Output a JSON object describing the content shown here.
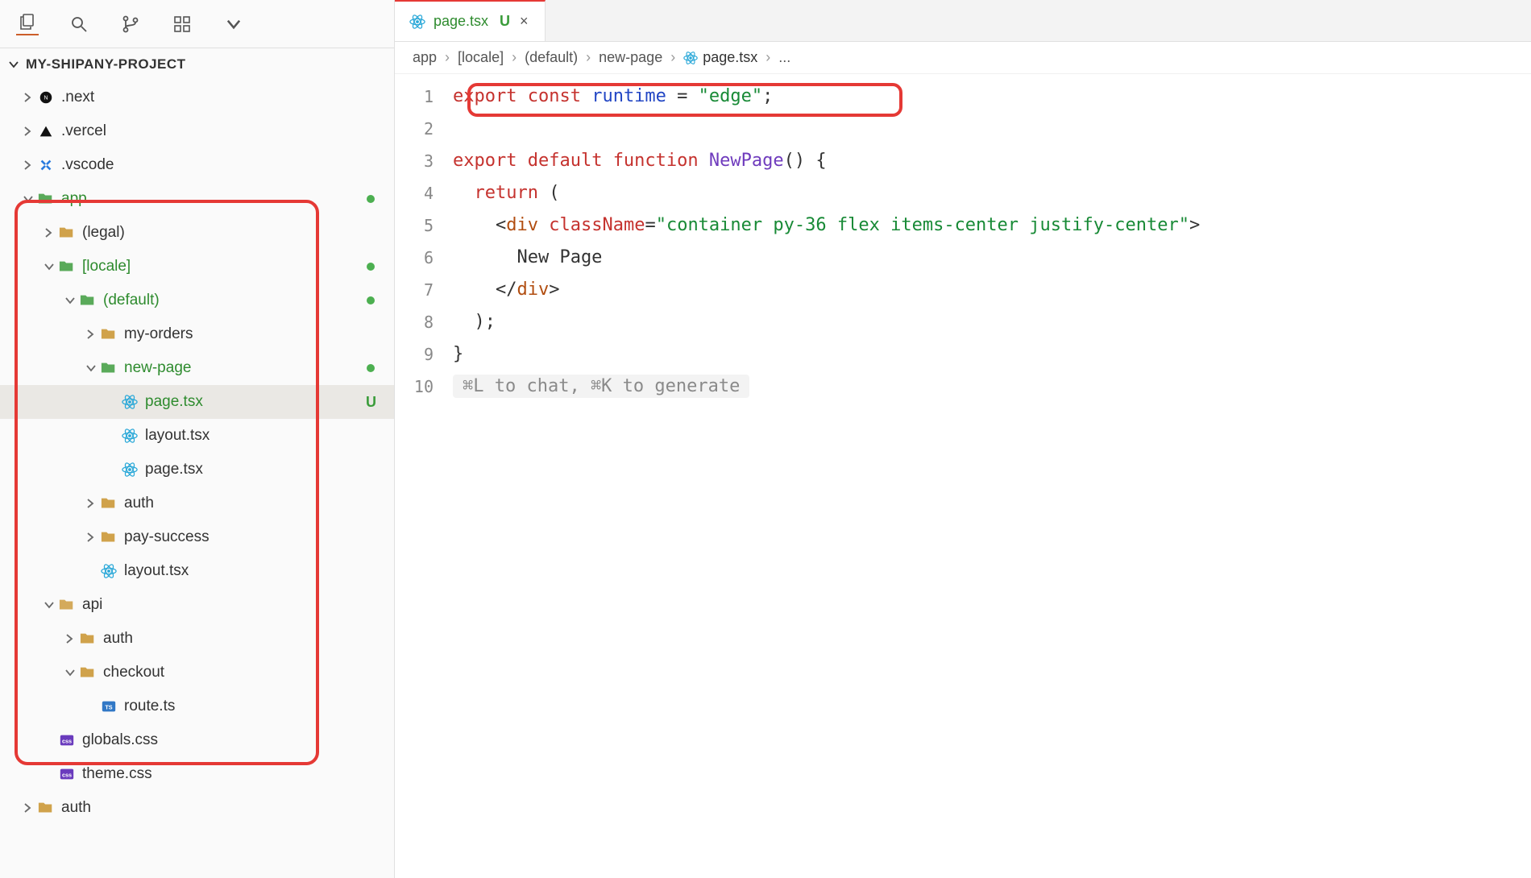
{
  "sidebar_top": {
    "icons": [
      "files-icon",
      "search-icon",
      "git-branch-icon",
      "extensions-icon",
      "chevron-down-icon"
    ]
  },
  "project": {
    "name": "MY-SHIPANY-PROJECT"
  },
  "tree": [
    {
      "depth": 0,
      "chev": ">",
      "icon": "next",
      "label": ".next"
    },
    {
      "depth": 0,
      "chev": ">",
      "icon": "vercel",
      "label": ".vercel"
    },
    {
      "depth": 0,
      "chev": ">",
      "icon": "vscode",
      "label": ".vscode"
    },
    {
      "depth": 0,
      "chev": "v",
      "icon": "folder-g",
      "label": "app",
      "green": true,
      "dot": true
    },
    {
      "depth": 1,
      "chev": ">",
      "icon": "folder",
      "label": "(legal)"
    },
    {
      "depth": 1,
      "chev": "v",
      "icon": "folder-g",
      "label": "[locale]",
      "green": true,
      "dot": true
    },
    {
      "depth": 2,
      "chev": "v",
      "icon": "folder-g",
      "label": "(default)",
      "green": true,
      "dot": true
    },
    {
      "depth": 3,
      "chev": ">",
      "icon": "folder",
      "label": "my-orders"
    },
    {
      "depth": 3,
      "chev": "v",
      "icon": "folder-g",
      "label": "new-page",
      "green": true,
      "dot": true
    },
    {
      "depth": 4,
      "chev": "",
      "icon": "react",
      "label": "page.tsx",
      "green": true,
      "u": "U",
      "selected": true
    },
    {
      "depth": 4,
      "chev": "",
      "icon": "react",
      "label": "layout.tsx"
    },
    {
      "depth": 4,
      "chev": "",
      "icon": "react",
      "label": "page.tsx"
    },
    {
      "depth": 3,
      "chev": ">",
      "icon": "folder",
      "label": "auth"
    },
    {
      "depth": 3,
      "chev": ">",
      "icon": "folder",
      "label": "pay-success"
    },
    {
      "depth": 3,
      "chev": "",
      "icon": "react",
      "label": "layout.tsx"
    },
    {
      "depth": 1,
      "chev": "v",
      "icon": "folder-api",
      "label": "api"
    },
    {
      "depth": 2,
      "chev": ">",
      "icon": "folder",
      "label": "auth"
    },
    {
      "depth": 2,
      "chev": "v",
      "icon": "folder",
      "label": "checkout"
    },
    {
      "depth": 3,
      "chev": "",
      "icon": "ts",
      "label": "route.ts"
    },
    {
      "depth": 1,
      "chev": "",
      "icon": "css",
      "label": "globals.css"
    },
    {
      "depth": 1,
      "chev": "",
      "icon": "css",
      "label": "theme.css"
    },
    {
      "depth": 0,
      "chev": ">",
      "icon": "folder",
      "label": "auth"
    }
  ],
  "tab": {
    "filename": "page.tsx",
    "badge": "U"
  },
  "breadcrumbs": [
    "app",
    "[locale]",
    "(default)",
    "new-page",
    "page.tsx",
    "..."
  ],
  "code": {
    "lines": [
      {
        "n": "1",
        "tokens": [
          [
            "kw",
            "export "
          ],
          [
            "kw",
            "const "
          ],
          [
            "var",
            "runtime"
          ],
          [
            "punc",
            " = "
          ],
          [
            "str",
            "\"edge\""
          ],
          [
            "punc",
            ";"
          ]
        ]
      },
      {
        "n": "2",
        "tokens": []
      },
      {
        "n": "3",
        "tokens": [
          [
            "kw",
            "export "
          ],
          [
            "kw",
            "default "
          ],
          [
            "kw",
            "function "
          ],
          [
            "fn",
            "NewPage"
          ],
          [
            "punc",
            "() {"
          ]
        ]
      },
      {
        "n": "4",
        "tokens": [
          [
            "txt",
            "  "
          ],
          [
            "kw",
            "return"
          ],
          [
            "punc",
            " ("
          ]
        ]
      },
      {
        "n": "5",
        "tokens": [
          [
            "txt",
            "    "
          ],
          [
            "punc",
            "<"
          ],
          [
            "tag",
            "div"
          ],
          [
            "txt",
            " "
          ],
          [
            "attr",
            "className"
          ],
          [
            "punc",
            "="
          ],
          [
            "str",
            "\"container py-36 flex items-center justify-center\""
          ],
          [
            "punc",
            ">"
          ]
        ]
      },
      {
        "n": "6",
        "tokens": [
          [
            "txt",
            "      New Page"
          ]
        ]
      },
      {
        "n": "7",
        "tokens": [
          [
            "txt",
            "    "
          ],
          [
            "punc",
            "</"
          ],
          [
            "tag",
            "div"
          ],
          [
            "punc",
            ">"
          ]
        ]
      },
      {
        "n": "8",
        "tokens": [
          [
            "txt",
            "  "
          ],
          [
            "punc",
            ");"
          ]
        ]
      },
      {
        "n": "9",
        "tokens": [
          [
            "punc",
            "}"
          ]
        ]
      },
      {
        "n": "10",
        "hint": "⌘L to chat, ⌘K to generate"
      }
    ]
  }
}
